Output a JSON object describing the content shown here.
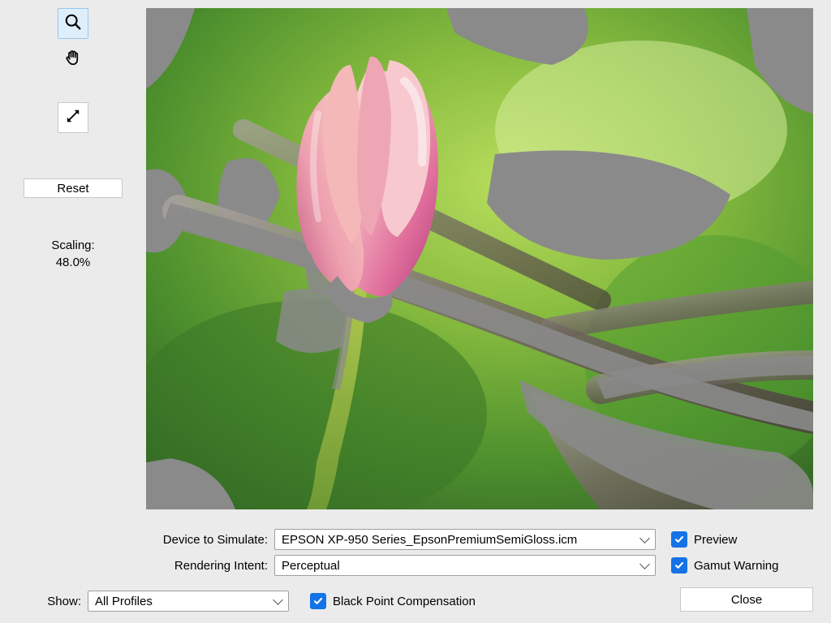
{
  "sidebar": {
    "reset_label": "Reset",
    "scaling_label": "Scaling:",
    "scaling_value": "48.0%"
  },
  "form": {
    "device_label": "Device to Simulate:",
    "device_value": "EPSON XP-950 Series_EpsonPremiumSemiGloss.icm",
    "intent_label": "Rendering Intent:",
    "intent_value": "Perceptual",
    "show_label": "Show:",
    "show_value": "All Profiles",
    "preview_label": "Preview",
    "gamut_label": "Gamut Warning",
    "bpc_label": "Black Point Compensation",
    "close_label": "Close"
  },
  "checkboxes": {
    "preview": true,
    "gamut": true,
    "bpc": true
  }
}
